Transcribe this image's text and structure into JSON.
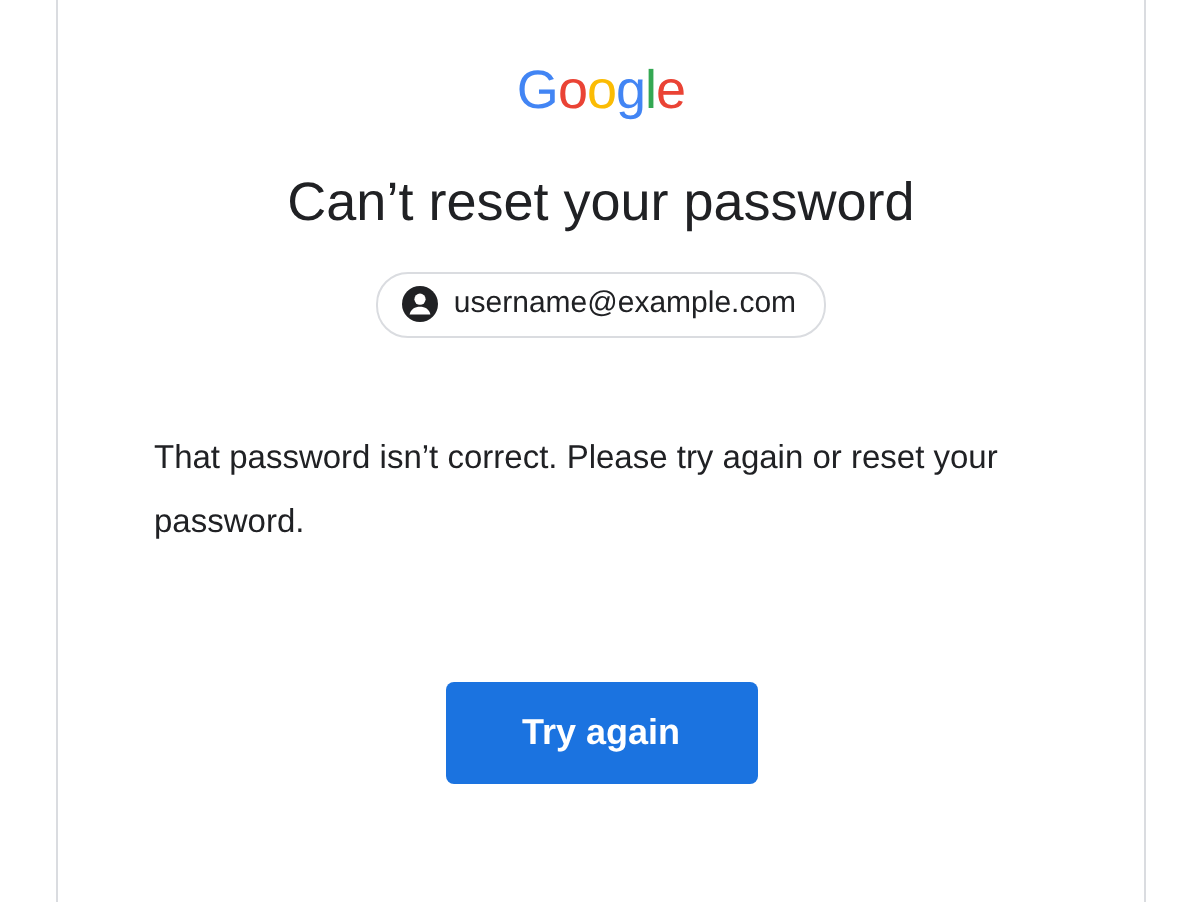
{
  "logo": "Google",
  "title": "Can’t reset your password",
  "account": {
    "email": "username@example.com"
  },
  "message": "That password isn’t correct. Please try again or reset your password.",
  "buttons": [
    {
      "label": "Try again",
      "kind": "primary"
    }
  ]
}
